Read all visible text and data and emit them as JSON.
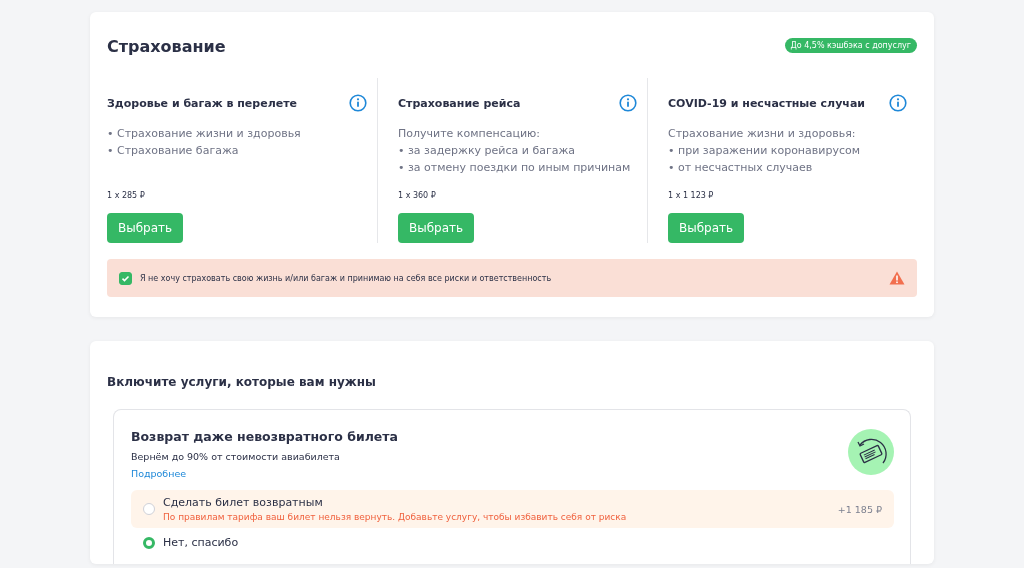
{
  "insurance": {
    "title": "Страхование",
    "cashback_badge": "До 4,5% кэшбэка с допуслуг",
    "options": [
      {
        "title": "Здоровье и багаж в перелете",
        "lines": [
          "• Страхование жизни и здоровья",
          "• Страхование багажа"
        ],
        "price": "1 x 285 ₽",
        "button": "Выбрать"
      },
      {
        "title": "Страхование рейса",
        "lines": [
          "Получите компенсацию:",
          "• за задержку рейса и багажа",
          "• за отмену поездки по иным причинам"
        ],
        "price": "1 x 360 ₽",
        "button": "Выбрать"
      },
      {
        "title": "COVID-19 и несчастные случаи",
        "lines": [
          "Страхование жизни и здоровья:",
          "• при заражении коронавирусом",
          "• от несчастных случаев"
        ],
        "price": "1 x 1 123 ₽",
        "button": "Выбрать"
      }
    ],
    "decline": {
      "text": "Я не хочу страховать свою жизнь и/или багаж и принимаю на себя все риски и ответственность",
      "checked": true
    }
  },
  "services": {
    "title": "Включите услуги, которые вам нужны",
    "refund": {
      "title": "Возврат даже невозвратного билета",
      "subtitle": "Вернём до 90% от стоимости авиабилета",
      "link": "Подробнее",
      "choices": [
        {
          "label": "Сделать билет возвратным",
          "note": "По правилам тарифа ваш билет нельзя вернуть. Добавьте услугу, чтобы избавить себя от риска",
          "price": "+1 185 ₽",
          "selected": false
        },
        {
          "label": "Нет, спасибо",
          "selected": true
        }
      ]
    }
  }
}
